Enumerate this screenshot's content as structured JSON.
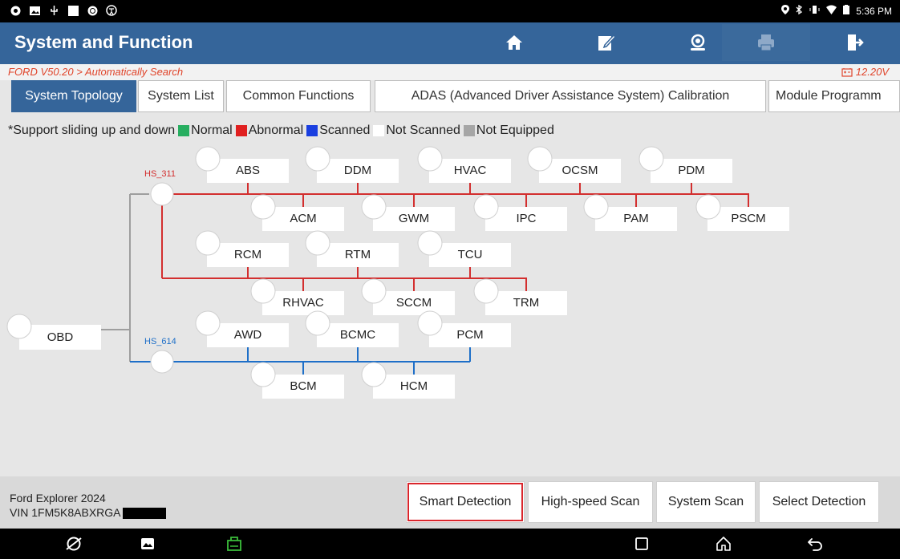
{
  "status": {
    "time": "5:36 PM"
  },
  "header": {
    "title": "System and Function",
    "buttons": [
      {
        "icon": "home-icon"
      },
      {
        "icon": "edit-report-icon"
      },
      {
        "icon": "support-agent-icon"
      },
      {
        "icon": "print-icon",
        "enabled": false
      },
      {
        "icon": "exit-icon"
      }
    ]
  },
  "breadcrumb": {
    "path": "FORD V50.20 > Automatically Search",
    "voltage": "12.20V"
  },
  "tabs": [
    {
      "label": "System Topology",
      "active": true
    },
    {
      "label": "System List"
    },
    {
      "label": "Common Functions"
    },
    {
      "label": "ADAS (Advanced Driver Assistance System) Calibration"
    },
    {
      "label": "Module Programm"
    }
  ],
  "legend": {
    "prefix": "*Support sliding up and down",
    "items": [
      {
        "label": "Normal",
        "color": "#27ae60"
      },
      {
        "label": "Abnormal",
        "color": "#e02020"
      },
      {
        "label": "Scanned",
        "color": "#1a3fe0"
      },
      {
        "label": "Not Scanned",
        "color": "#ffffff"
      },
      {
        "label": "Not Equipped",
        "color": "#a6a6a6"
      }
    ]
  },
  "topology": {
    "root": "OBD",
    "buses": [
      {
        "name": "HS_311",
        "color": "#d32f2f"
      },
      {
        "name": "HS_614",
        "color": "#1e6fc8"
      }
    ],
    "modules": [
      "ABS",
      "DDM",
      "HVAC",
      "OCSM",
      "PDM",
      "ACM",
      "GWM",
      "IPC",
      "PAM",
      "PSCM",
      "RCM",
      "RTM",
      "TCU",
      "RHVAC",
      "SCCM",
      "TRM",
      "AWD",
      "BCMC",
      "PCM",
      "BCM",
      "HCM"
    ]
  },
  "vehicle": {
    "name": "Ford Explorer 2024",
    "vin": "VIN 1FM5K8ABXRGA"
  },
  "actions": [
    "Smart Detection",
    "High-speed Scan",
    "System Scan",
    "Select Detection"
  ],
  "colors": {
    "header": "#35659a",
    "accent": "#e0442a"
  }
}
